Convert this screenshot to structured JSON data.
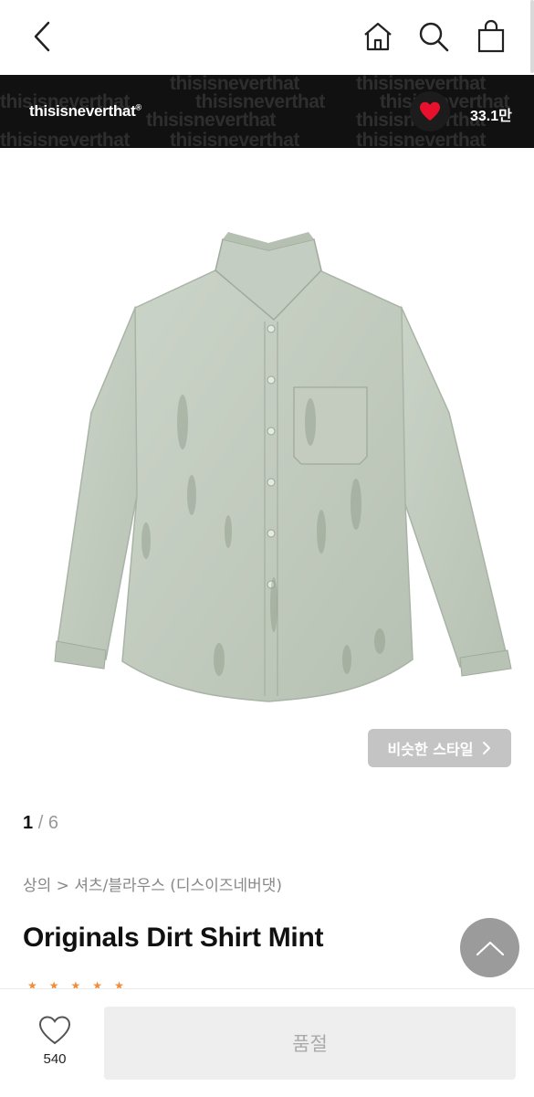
{
  "topbar": {
    "back_icon": "chevron-left-icon",
    "home_icon": "home-icon",
    "search_icon": "search-icon",
    "cart_icon": "shopping-bag-icon"
  },
  "brand": {
    "name": "thisisneverthat",
    "registered_mark": "®",
    "watermark_text": "thisisneverthat",
    "favorite_count": "33.1만",
    "heart_color": "#e8112d"
  },
  "gallery": {
    "current": "1",
    "separator": "/",
    "total": "6",
    "similar_style_label": "비슷한 스타일"
  },
  "product": {
    "breadcrumb": "상의 > 셔츠/블라우스 (디스이즈네버댓)",
    "title": "Originals Dirt Shirt Mint",
    "rating_stars": 5,
    "star_color": "#f28c3a"
  },
  "bottom_bar": {
    "wish_count": "540",
    "soldout_label": "품절"
  }
}
